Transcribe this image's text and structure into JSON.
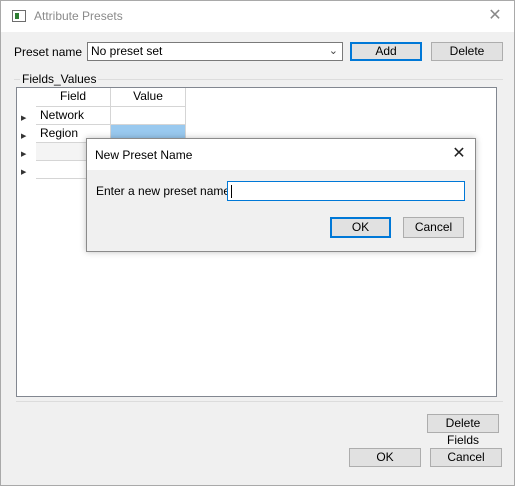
{
  "window": {
    "title": "Attribute Presets",
    "close_glyph": "✕"
  },
  "preset": {
    "label": "Preset name",
    "selected": "No preset set",
    "add_label": "Add",
    "delete_label": "Delete"
  },
  "group": {
    "title": "Fields_Values"
  },
  "grid": {
    "headers": [
      "Field",
      "Value"
    ],
    "rows": [
      {
        "field": "Network",
        "value": ""
      },
      {
        "field": "Region",
        "value": ""
      },
      {
        "field": "",
        "value": ""
      },
      {
        "field": "",
        "value": ""
      }
    ],
    "selected_cell_color": "#99c9ef"
  },
  "footer": {
    "delete_fields_label": "Delete Fields",
    "ok_label": "OK",
    "cancel_label": "Cancel"
  },
  "dialog": {
    "title": "New Preset Name",
    "close_glyph": "✕",
    "prompt": "Enter a new preset name.",
    "input_value": "",
    "ok_label": "OK",
    "cancel_label": "Cancel"
  },
  "colors": {
    "accent": "#0078d7",
    "button_face": "#e1e1e1",
    "window_bg": "#f0f0f0"
  }
}
